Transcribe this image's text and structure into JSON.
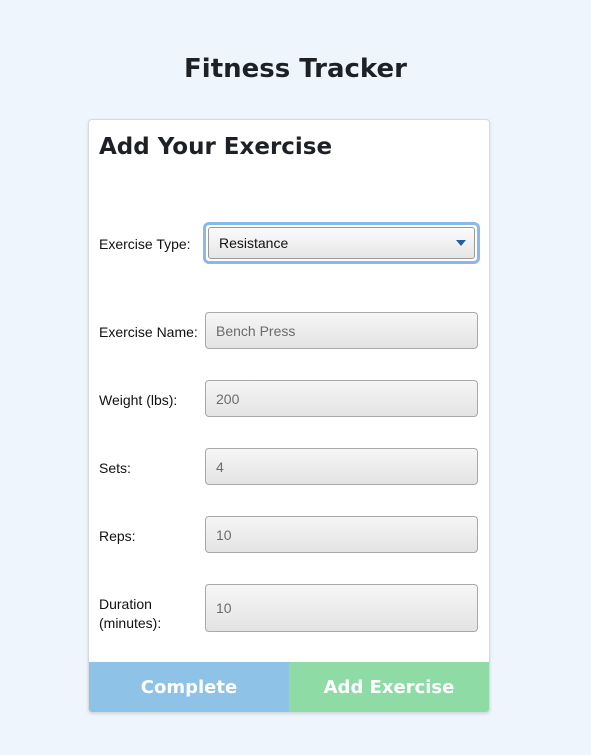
{
  "page": {
    "title": "Fitness Tracker"
  },
  "form": {
    "heading": "Add Your Exercise",
    "exercise_type": {
      "label": "Exercise Type:",
      "selected": "Resistance"
    },
    "exercise_name": {
      "label": "Exercise Name:",
      "placeholder": "Bench Press"
    },
    "weight": {
      "label": "Weight (lbs):",
      "placeholder": "200"
    },
    "sets": {
      "label": "Sets:",
      "placeholder": "4"
    },
    "reps": {
      "label": "Reps:",
      "placeholder": "10"
    },
    "duration": {
      "label": "Duration (minutes):",
      "placeholder": "10"
    }
  },
  "buttons": {
    "complete_label": "Complete",
    "add_label": "Add Exercise"
  },
  "colors": {
    "background": "#eef5fd",
    "complete_button": "#8ec2e6",
    "add_button": "#8edba6",
    "focus_ring": "#8ab8e8",
    "chevron": "#1e5fa8"
  },
  "icons": {
    "select_arrow": "chevron-down-icon"
  }
}
